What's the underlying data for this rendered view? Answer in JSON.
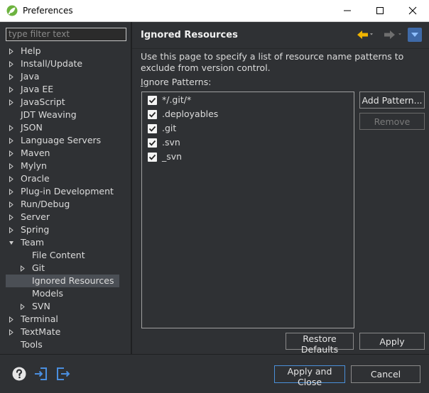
{
  "window": {
    "title": "Preferences"
  },
  "sidebar": {
    "filter_placeholder": "type filter text",
    "items": [
      {
        "label": "Help",
        "expandable": true
      },
      {
        "label": "Install/Update",
        "expandable": true
      },
      {
        "label": "Java",
        "expandable": true
      },
      {
        "label": "Java EE",
        "expandable": true
      },
      {
        "label": "JavaScript",
        "expandable": true
      },
      {
        "label": "JDT Weaving",
        "expandable": false
      },
      {
        "label": "JSON",
        "expandable": true
      },
      {
        "label": "Language Servers",
        "expandable": true
      },
      {
        "label": "Maven",
        "expandable": true
      },
      {
        "label": "Mylyn",
        "expandable": true
      },
      {
        "label": "Oracle",
        "expandable": true
      },
      {
        "label": "Plug-in Development",
        "expandable": true
      },
      {
        "label": "Run/Debug",
        "expandable": true
      },
      {
        "label": "Server",
        "expandable": true
      },
      {
        "label": "Spring",
        "expandable": true
      },
      {
        "label": "Team",
        "expandable": true,
        "expanded": true
      },
      {
        "label": "File Content",
        "expandable": false,
        "child": true
      },
      {
        "label": "Git",
        "expandable": true,
        "child": true
      },
      {
        "label": "Ignored Resources",
        "expandable": false,
        "child": true,
        "selected": true
      },
      {
        "label": "Models",
        "expandable": false,
        "child": true
      },
      {
        "label": "SVN",
        "expandable": true,
        "child": true
      },
      {
        "label": "Terminal",
        "expandable": true
      },
      {
        "label": "TextMate",
        "expandable": true
      },
      {
        "label": "Tools",
        "expandable": false
      }
    ]
  },
  "page": {
    "title": "Ignored Resources",
    "description": "Use this page to specify a list of resource name patterns to exclude from version control.",
    "patterns_label": "Ignore Patterns:",
    "patterns": [
      {
        "text": "*/.git/*",
        "checked": true
      },
      {
        "text": ".deployables",
        "checked": true
      },
      {
        "text": ".git",
        "checked": true
      },
      {
        "text": ".svn",
        "checked": true
      },
      {
        "text": "_svn",
        "checked": true
      }
    ],
    "add_pattern_label": "Add Pattern...",
    "remove_label": "Remove",
    "restore_defaults_label": "Restore Defaults",
    "apply_label": "Apply"
  },
  "footer": {
    "apply_close_label": "Apply and Close",
    "cancel_label": "Cancel"
  },
  "colors": {
    "background": "#2f3134",
    "accent": "#4a90d9",
    "back_arrow": "#f0b400"
  },
  "icons": {
    "app": "eclipse-leaf-icon",
    "back": "back-arrow-icon",
    "forward": "forward-arrow-icon",
    "menu": "view-menu-icon",
    "help": "help-icon",
    "import": "import-icon",
    "export": "export-icon"
  }
}
